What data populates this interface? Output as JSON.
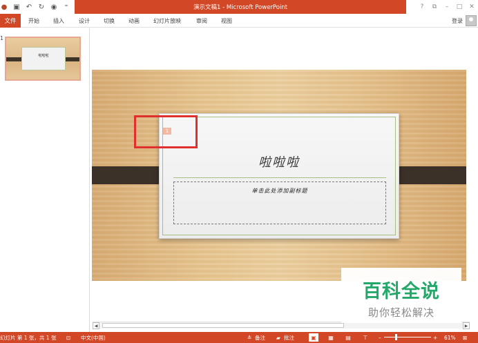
{
  "window": {
    "title": "演示文稿1 - Microsoft PowerPoint",
    "controls": [
      "?",
      "⧉",
      "–",
      "□",
      "✕"
    ]
  },
  "ribbon": {
    "file_tab": "文件",
    "tabs": [
      "开始",
      "插入",
      "设计",
      "切换",
      "动画",
      "幻灯片放映",
      "审阅",
      "视图"
    ],
    "login": "登录"
  },
  "thumbnail": {
    "slide_number": "1",
    "title": "啦啦啦"
  },
  "slide": {
    "title": "啦啦啦",
    "subtitle_placeholder": "单击此处添加副标题",
    "page_number_tag": "1"
  },
  "status": {
    "slide_info": "幻灯片 第 1 张，共 1 张",
    "language": "中文(中国)",
    "notes": "备注",
    "comments": "批注",
    "zoom": "61%"
  },
  "watermark": {
    "brand": "百科全说",
    "tagline": "助你轻松解决"
  },
  "colors": {
    "accent": "#d24726",
    "highlight_box": "#e0302d",
    "watermark_green": "#24a869"
  }
}
